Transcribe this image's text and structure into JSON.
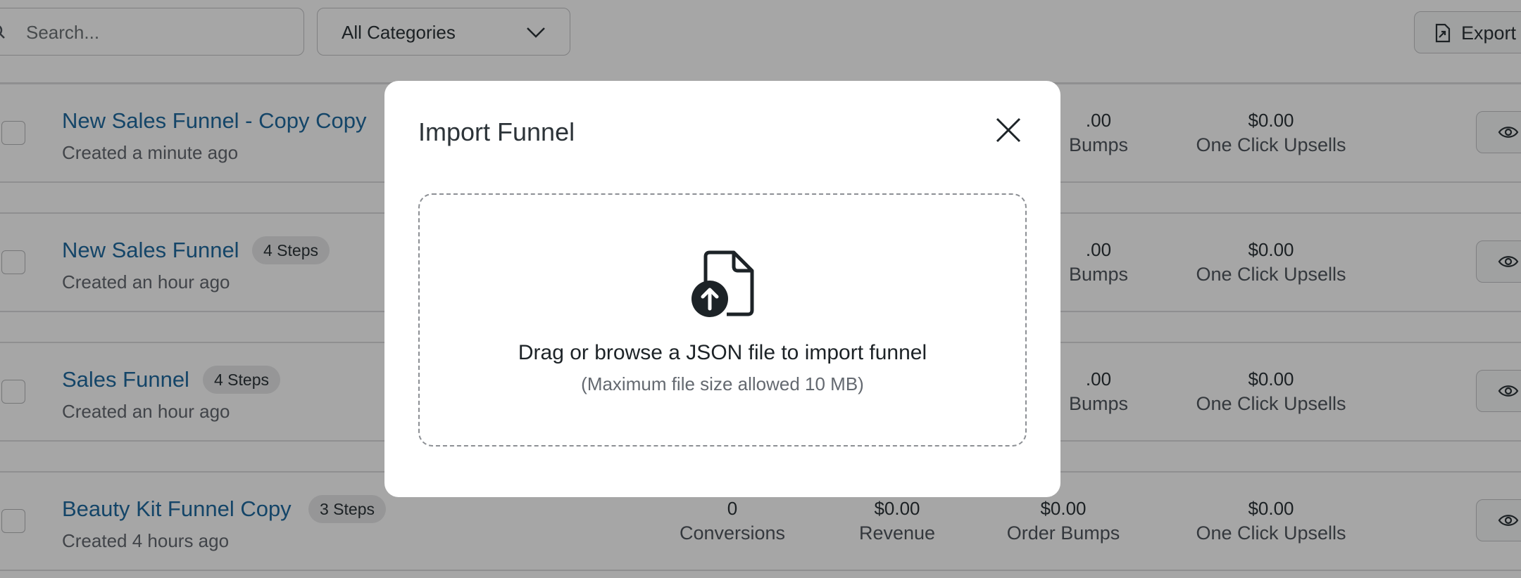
{
  "toolbar": {
    "search_placeholder": "Search...",
    "category_select": "All Categories",
    "export_label": "Export"
  },
  "funnels": [
    {
      "title": "New Sales Funnel - Copy Copy",
      "steps": "",
      "created": "Created a minute ago",
      "conversions": "",
      "revenue": "",
      "order_bumps": ".00",
      "upsells": "$0.00"
    },
    {
      "title": "New Sales Funnel",
      "steps": "4 Steps",
      "created": "Created an hour ago",
      "conversions": "",
      "revenue": "",
      "order_bumps": ".00",
      "upsells": "$0.00"
    },
    {
      "title": "Sales Funnel",
      "steps": "4 Steps",
      "created": "Created an hour ago",
      "conversions": "",
      "revenue": "",
      "order_bumps": ".00",
      "upsells": "$0.00"
    },
    {
      "title": "Beauty Kit Funnel Copy",
      "steps": "3 Steps",
      "created": "Created 4 hours ago",
      "conversions": "0",
      "revenue": "$0.00",
      "order_bumps": "$0.00",
      "upsells": "$0.00"
    }
  ],
  "stat_labels": {
    "conversions": "Conversions",
    "revenue": "Revenue",
    "order_bumps": "Order Bumps",
    "order_bumps_partial": "Bumps",
    "upsells": "One Click Upsells"
  },
  "modal": {
    "title": "Import Funnel",
    "dropzone_text": "Drag or browse a JSON file to import funnel",
    "dropzone_hint": "(Maximum file size allowed 10 MB)",
    "close_icon": "close-icon",
    "upload_icon": "file-upload-icon"
  }
}
